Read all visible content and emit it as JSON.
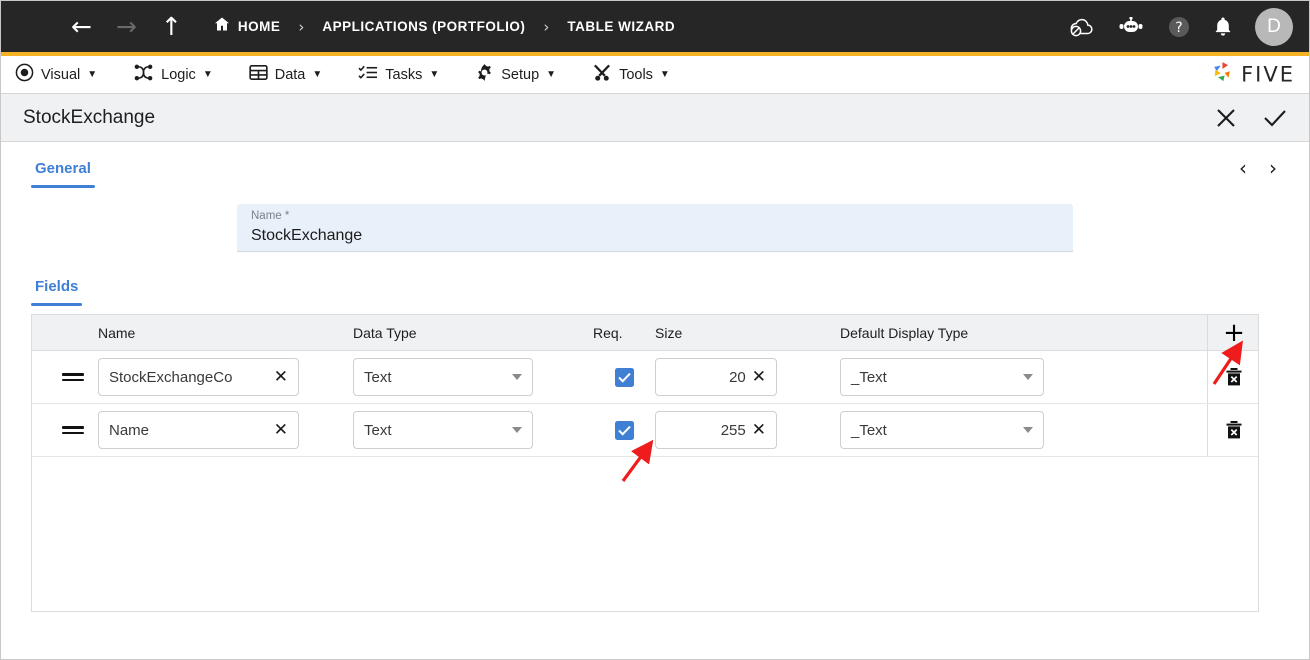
{
  "topbar": {
    "menu_icon": "hamburger-icon",
    "back_icon": "arrow-left-icon",
    "forward_icon": "arrow-right-icon",
    "up_icon": "arrow-up-icon",
    "breadcrumbs": [
      {
        "label": "HOME",
        "icon": "home-icon"
      },
      {
        "label": "APPLICATIONS (PORTFOLIO)",
        "icon": ""
      },
      {
        "label": "TABLE WIZARD",
        "icon": ""
      }
    ],
    "separator": "›",
    "actions": [
      {
        "name": "cloud-off-icon"
      },
      {
        "name": "robot-chat-icon"
      },
      {
        "name": "help-icon"
      },
      {
        "name": "notifications-bell-icon"
      }
    ],
    "avatar_initial": "D",
    "bar_color": "#262626",
    "accent_color": "#f5b323"
  },
  "menubar": {
    "items": [
      {
        "label": "Visual",
        "icon": "eye-icon"
      },
      {
        "label": "Logic",
        "icon": "logic-nodes-icon"
      },
      {
        "label": "Data",
        "icon": "table-grid-icon"
      },
      {
        "label": "Tasks",
        "icon": "task-list-icon"
      },
      {
        "label": "Setup",
        "icon": "gear-icon"
      },
      {
        "label": "Tools",
        "icon": "tools-icon"
      }
    ],
    "caret": "▼",
    "brand": "FIVE"
  },
  "titlebar": {
    "title": "StockExchange",
    "close_icon": "close-x-icon",
    "confirm_icon": "checkmark-icon"
  },
  "general": {
    "tab_label": "General",
    "prev_icon": "‹",
    "next_icon": "›",
    "name_label": "Name *",
    "name_value": "StockExchange"
  },
  "fields": {
    "tab_label": "Fields",
    "add_icon": "+",
    "columns": [
      "",
      "Name",
      "Data Type",
      "Req.",
      "Size",
      "Default Display Type",
      ""
    ],
    "rows": [
      {
        "handle": "drag-handle-icon",
        "name": "StockExchangeCo",
        "data_type": "Text",
        "required": true,
        "size": "20",
        "display_type": "_Text",
        "clear_icon": "✕",
        "delete_icon": "trash-delete-icon"
      },
      {
        "handle": "drag-handle-icon",
        "name": "Name",
        "data_type": "Text",
        "required": true,
        "size": "255",
        "display_type": "_Text",
        "clear_icon": "✕",
        "delete_icon": "trash-delete-icon"
      }
    ]
  },
  "annotations": {
    "arrow_color": "#ee1c1c",
    "arrows": [
      {
        "name": "arrow-to-add-field-button"
      },
      {
        "name": "arrow-to-required-checkbox-row-2"
      }
    ]
  },
  "theme": {
    "accent_blue": "#3f7fd4",
    "header_bg": "#f0f1f3",
    "field_bg": "#e8f0fa"
  }
}
